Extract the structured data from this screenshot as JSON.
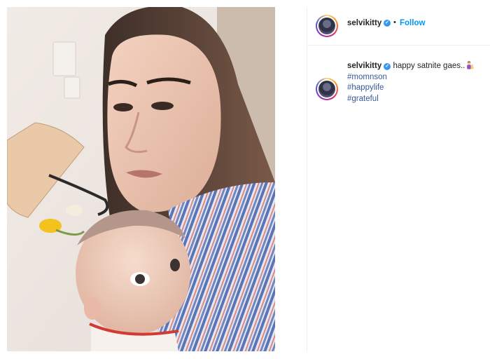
{
  "post": {
    "username": "selvikitty",
    "follow_label": "Follow",
    "separator": "•",
    "caption_text": "happy satnite gaes..",
    "hashtags": [
      "#momnson",
      "#happylife",
      "#grateful"
    ]
  },
  "icons": {
    "verified": "verified-badge-icon",
    "emoji": "woman-with-baby-emoji-icon"
  },
  "colors": {
    "follow": "#0095f6",
    "hashtag": "#385898",
    "verified": "#3897f0"
  }
}
